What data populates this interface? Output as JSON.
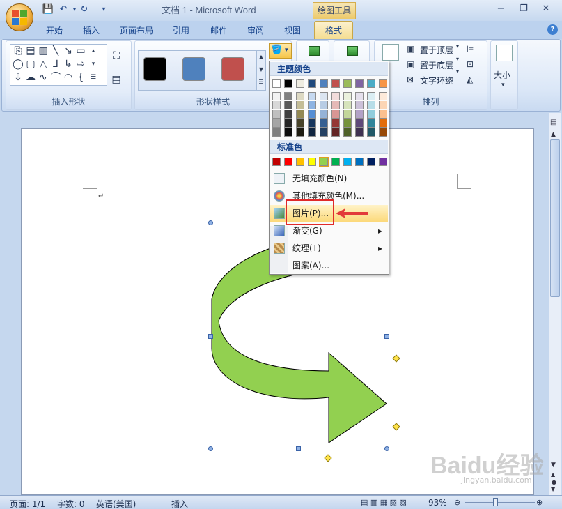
{
  "window": {
    "title": "文档 1 - Microsoft Word",
    "context_tab": "绘图工具"
  },
  "ribbon_tabs": [
    "开始",
    "插入",
    "页面布局",
    "引用",
    "邮件",
    "审阅",
    "视图",
    "格式"
  ],
  "active_tab": "格式",
  "groups": {
    "insert_shapes": "插入形状",
    "shape_styles": "形状样式",
    "arrange": "排列",
    "size": "大小"
  },
  "arrange_items": [
    "置于顶层",
    "置于底层",
    "文字环绕"
  ],
  "style_swatch_colors": [
    "#000000",
    "#4f81bd",
    "#c0504d"
  ],
  "fill_menu": {
    "theme_colors_title": "主题颜色",
    "standard_colors_title": "标准色",
    "theme_top_row": [
      "#ffffff",
      "#000000",
      "#eeece1",
      "#1f497d",
      "#4f81bd",
      "#c0504d",
      "#9bbb59",
      "#8064a2",
      "#4bacc6",
      "#f79646"
    ],
    "theme_shades": [
      [
        "#f2f2f2",
        "#d8d8d8",
        "#bfbfbf",
        "#a5a5a5",
        "#7f7f7f"
      ],
      [
        "#7f7f7f",
        "#595959",
        "#3f3f3f",
        "#262626",
        "#0c0c0c"
      ],
      [
        "#ddd9c3",
        "#c4bd97",
        "#938953",
        "#494429",
        "#1d1b10"
      ],
      [
        "#c6d9f0",
        "#8db3e2",
        "#548dd4",
        "#17365d",
        "#0f243e"
      ],
      [
        "#dbe5f1",
        "#b8cce4",
        "#95b3d7",
        "#366092",
        "#244061"
      ],
      [
        "#f2dcdb",
        "#e5b9b7",
        "#d99694",
        "#953734",
        "#632423"
      ],
      [
        "#ebf1dd",
        "#d7e3bc",
        "#c3d69b",
        "#76923c",
        "#4f6128"
      ],
      [
        "#e5e0ec",
        "#ccc1d9",
        "#b2a2c7",
        "#5f497a",
        "#3f3151"
      ],
      [
        "#dbeef3",
        "#b7dde8",
        "#92cddc",
        "#31859b",
        "#205867"
      ],
      [
        "#fdeada",
        "#fbd5b5",
        "#fac08f",
        "#e36c09",
        "#974806"
      ]
    ],
    "standard_colors": [
      "#c00000",
      "#ff0000",
      "#ffc000",
      "#ffff00",
      "#92d050",
      "#00b050",
      "#00b0f0",
      "#0070c0",
      "#002060",
      "#7030a0"
    ],
    "items": [
      {
        "label": "无填充颜色(N)",
        "icon": "no-fill-icon"
      },
      {
        "label": "其他填充颜色(M)...",
        "icon": "palette-icon"
      },
      {
        "label": "图片(P)...",
        "icon": "picture-icon"
      },
      {
        "label": "渐变(G)",
        "icon": "gradient-icon",
        "submenu": true
      },
      {
        "label": "纹理(T)",
        "icon": "texture-icon",
        "submenu": true
      },
      {
        "label": "图案(A)...",
        "icon": "pattern-icon"
      }
    ]
  },
  "shape": {
    "fill_color": "#92d050",
    "shadow_color": "#76a33a",
    "outline_color": "#000000"
  },
  "status": {
    "page": "页面: 1/1",
    "words": "字数: 0",
    "language": "英语(美国)",
    "mode": "插入",
    "zoom": "93%"
  },
  "watermark": {
    "text": "Baidu经验",
    "url": "jingyan.baidu.com"
  }
}
